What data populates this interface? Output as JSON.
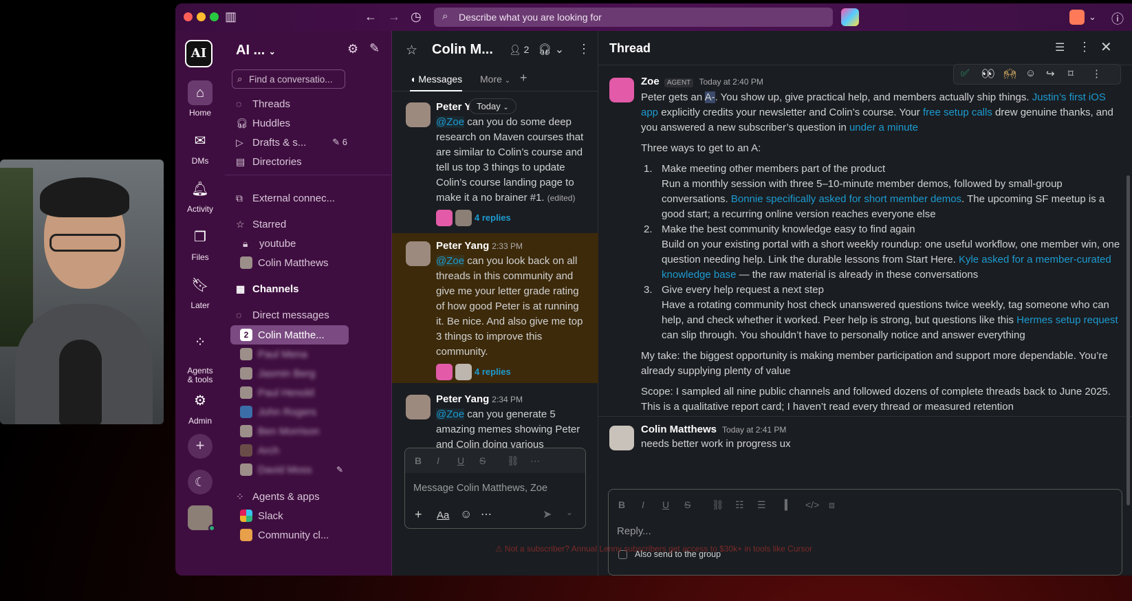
{
  "titlebar": {
    "search_placeholder": "Describe what you are looking for"
  },
  "rail": {
    "workspace_logo": "AI",
    "items": [
      {
        "label": "Home",
        "icon": "home-icon"
      },
      {
        "label": "DMs",
        "icon": "dm-icon"
      },
      {
        "label": "Activity",
        "icon": "bell-icon"
      },
      {
        "label": "Files",
        "icon": "files-icon"
      },
      {
        "label": "Later",
        "icon": "bookmark-icon"
      },
      {
        "label": "Agents\n& tools",
        "icon": "agents-icon"
      },
      {
        "label": "Admin",
        "icon": "gear-icon"
      }
    ]
  },
  "sidebar": {
    "workspace_name": "AI ...",
    "find_placeholder": "Find a conversatio...",
    "items": {
      "threads": "Threads",
      "huddles": "Huddles",
      "drafts": "Drafts & s...",
      "drafts_count": "6",
      "directories": "Directories",
      "external": "External connec...",
      "starred": "Starred",
      "youtube": "youtube",
      "colin": "Colin Matthews",
      "channels": "Channels",
      "direct_messages": "Direct messages",
      "active_dm": "Colin Matthe...",
      "active_dm_badge": "2",
      "blurred": [
        "Paul Mena",
        "Jasmin Berg",
        "Paul Henold",
        "John Rogers",
        "Ben Morrison",
        "Arch",
        "David Moss"
      ],
      "agents_apps": "Agents & apps",
      "slack": "Slack",
      "community": "Community cl..."
    }
  },
  "channel": {
    "title": "Colin M...",
    "members_count": "2",
    "tabs": {
      "messages": "Messages",
      "more": "More"
    },
    "today_pill": "Today",
    "messages": [
      {
        "name": "Peter Y.",
        "time": "",
        "mention": "@Zoe",
        "text": " can you do some deep research on Maven courses that are similar to Colin’s course and tell us top 3 things to update Colin’s course landing page to make it a no brainer #1.",
        "edited": "(edited)",
        "replies": "4 replies"
      },
      {
        "name": "Peter Yang",
        "time": "2:33 PM",
        "mention": "@Zoe",
        "text": " can you look back on all threads in this community and give me your letter grade rating of how good Peter is at running it. Be nice. And also give me top 3 things to improve this community.",
        "edited": "",
        "replies": "4 replies"
      },
      {
        "name": "Peter Yang",
        "time": "2:34 PM",
        "mention": "@Zoe",
        "text": " can you generate 5 amazing memes showing Peter and Colin doing various",
        "edited": "",
        "replies": ""
      }
    ],
    "composer_placeholder": "Message Colin Matthews, Zoe"
  },
  "thread": {
    "title": "Thread",
    "zoe": {
      "name": "Zoe",
      "badge": "AGENT",
      "time": "Today at 2:40 PM",
      "p1_a": "Peter gets an ",
      "p1_grade": "A-",
      "p1_b": ". You show up, give practical help, and members actually ship things. ",
      "p1_link1": "Justin’s first iOS app",
      "p1_c": " explicitly credits your newsletter and Colin’s course. Your ",
      "p1_link2": "free setup calls",
      "p1_d": " drew genuine thanks, and you answered a new subscriber’s question in ",
      "p1_link3": "under a minute",
      "intro": "Three ways to get to an A:",
      "items": [
        {
          "num": "1.",
          "title": "Make meeting other members part of the product",
          "a": "Run a monthly session with three 5–10-minute member demos, followed by small-group conversations. ",
          "link": "Bonnie specifically asked for short member demos",
          "b": ". The upcoming SF meetup is a good start; a recurring online version reaches everyone else"
        },
        {
          "num": "2.",
          "title": "Make the best community knowledge easy to find again",
          "a": "Build on your existing portal with a short weekly roundup: one useful workflow, one member win, one question needing help. Link the durable lessons from Start Here. ",
          "link": "Kyle asked for a member-curated knowledge base",
          "b": " — the raw material is already in these conversations"
        },
        {
          "num": "3.",
          "title": "Give every help request a next step",
          "a": "Have a rotating community host check unanswered questions twice weekly, tag someone who can help, and check whether it worked. Peer help is strong, but questions like this ",
          "link": "Hermes setup request",
          "b": " can slip through. You shouldn’t have to personally notice and answer everything"
        }
      ],
      "take": "My take: the biggest opportunity is making member participation and support more dependable. You’re already supplying plenty of value",
      "scope": "Scope: I sampled all nine public channels and followed dozens of complete threads back to June 2025. This is a qualitative report card; I haven’t read every thread or measured retention"
    },
    "colin": {
      "name": "Colin Matthews",
      "time": "Today at 2:41 PM",
      "text": "needs better work in progress ux"
    },
    "reply_placeholder": "Reply...",
    "also_send": "Also send to the group"
  },
  "banner": "Not a subscriber? Annual Lenny subscribers get access to $30k+ in tools like Cursor",
  "colors": {
    "aubergine": "#3f0e40",
    "link": "#1d9bd1",
    "bg": "#1a1d21",
    "highlight": "#3d2a0a"
  }
}
